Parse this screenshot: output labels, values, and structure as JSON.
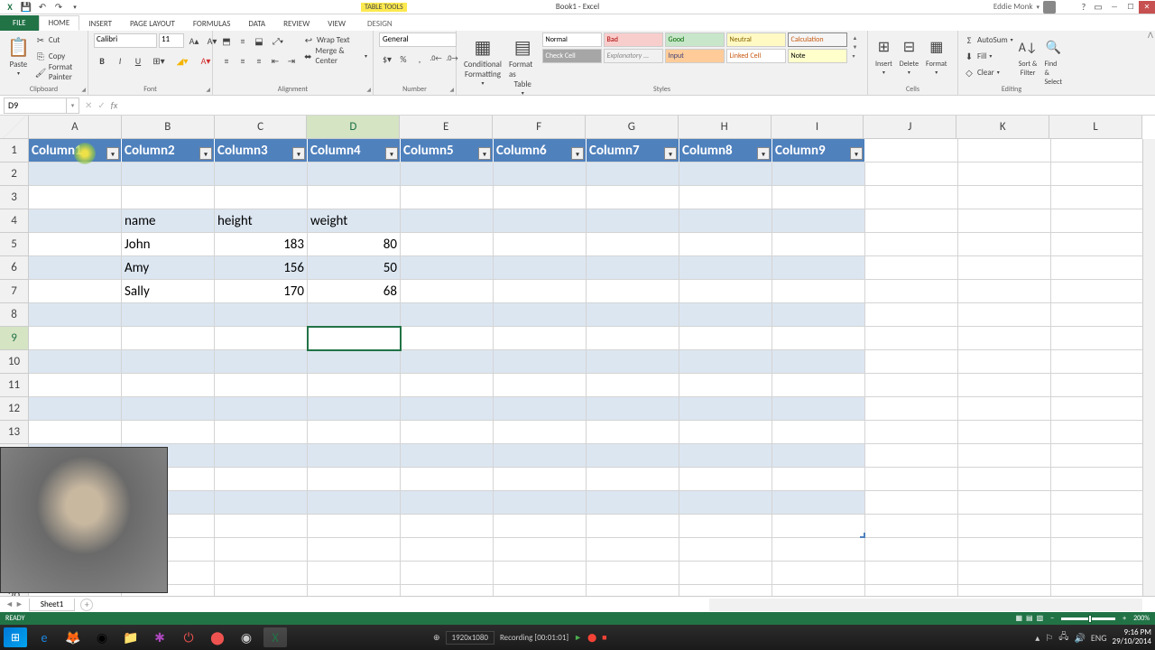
{
  "titlebar": {
    "appTitle": "Book1 - Excel",
    "tableTools": "TABLE TOOLS",
    "user": "Eddie Monk"
  },
  "tabs": {
    "file": "FILE",
    "home": "HOME",
    "insert": "INSERT",
    "pageLayout": "PAGE LAYOUT",
    "formulas": "FORMULAS",
    "data": "DATA",
    "review": "REVIEW",
    "view": "VIEW",
    "design": "DESIGN"
  },
  "clipboard": {
    "label": "Clipboard",
    "paste": "Paste",
    "cut": "Cut",
    "copy": "Copy",
    "fmt": "Format Painter"
  },
  "font": {
    "label": "Font",
    "name": "Calibri",
    "size": "11"
  },
  "alignment": {
    "label": "Alignment",
    "wrap": "Wrap Text",
    "merge": "Merge & Center"
  },
  "number": {
    "label": "Number",
    "format": "General"
  },
  "styles": {
    "label": "Styles",
    "cond": "Conditional",
    "cond2": "Formatting",
    "fmtAs": "Format as",
    "fmtAs2": "Table",
    "normal": "Normal",
    "bad": "Bad",
    "good": "Good",
    "neutral": "Neutral",
    "calc": "Calculation",
    "check": "Check Cell",
    "expl": "Explanatory ...",
    "input": "Input",
    "linked": "Linked Cell",
    "note": "Note"
  },
  "cells": {
    "label": "Cells",
    "insert": "Insert",
    "delete": "Delete",
    "format": "Format"
  },
  "editing": {
    "label": "Editing",
    "sum": "AutoSum",
    "fill": "Fill",
    "clear": "Clear",
    "sort": "Sort &",
    "sort2": "Filter",
    "find": "Find &",
    "find2": "Select"
  },
  "nameBox": "D9",
  "columns": [
    "A",
    "B",
    "C",
    "D",
    "E",
    "F",
    "G",
    "H",
    "I",
    "J",
    "K",
    "L"
  ],
  "tableHeaders": [
    "Column1",
    "Column2",
    "Column3",
    "Column4",
    "Column5",
    "Column6",
    "Column7",
    "Column8",
    "Column9"
  ],
  "data": {
    "labelRow": {
      "b": "name",
      "c": "height",
      "d": "weight"
    },
    "rows": [
      {
        "b": "John",
        "c": "183",
        "d": "80"
      },
      {
        "b": "Amy",
        "c": "156",
        "d": "50"
      },
      {
        "b": "Sally",
        "c": "170",
        "d": "68"
      }
    ]
  },
  "sheet": "Sheet1",
  "status": {
    "ready": "READY",
    "zoom": "200%"
  },
  "recording": {
    "res": "1920x1080",
    "label": "Recording [00:01:01]"
  },
  "tray": {
    "lang": "ENG",
    "time": "9:16 PM",
    "date": "29/10/2014"
  }
}
